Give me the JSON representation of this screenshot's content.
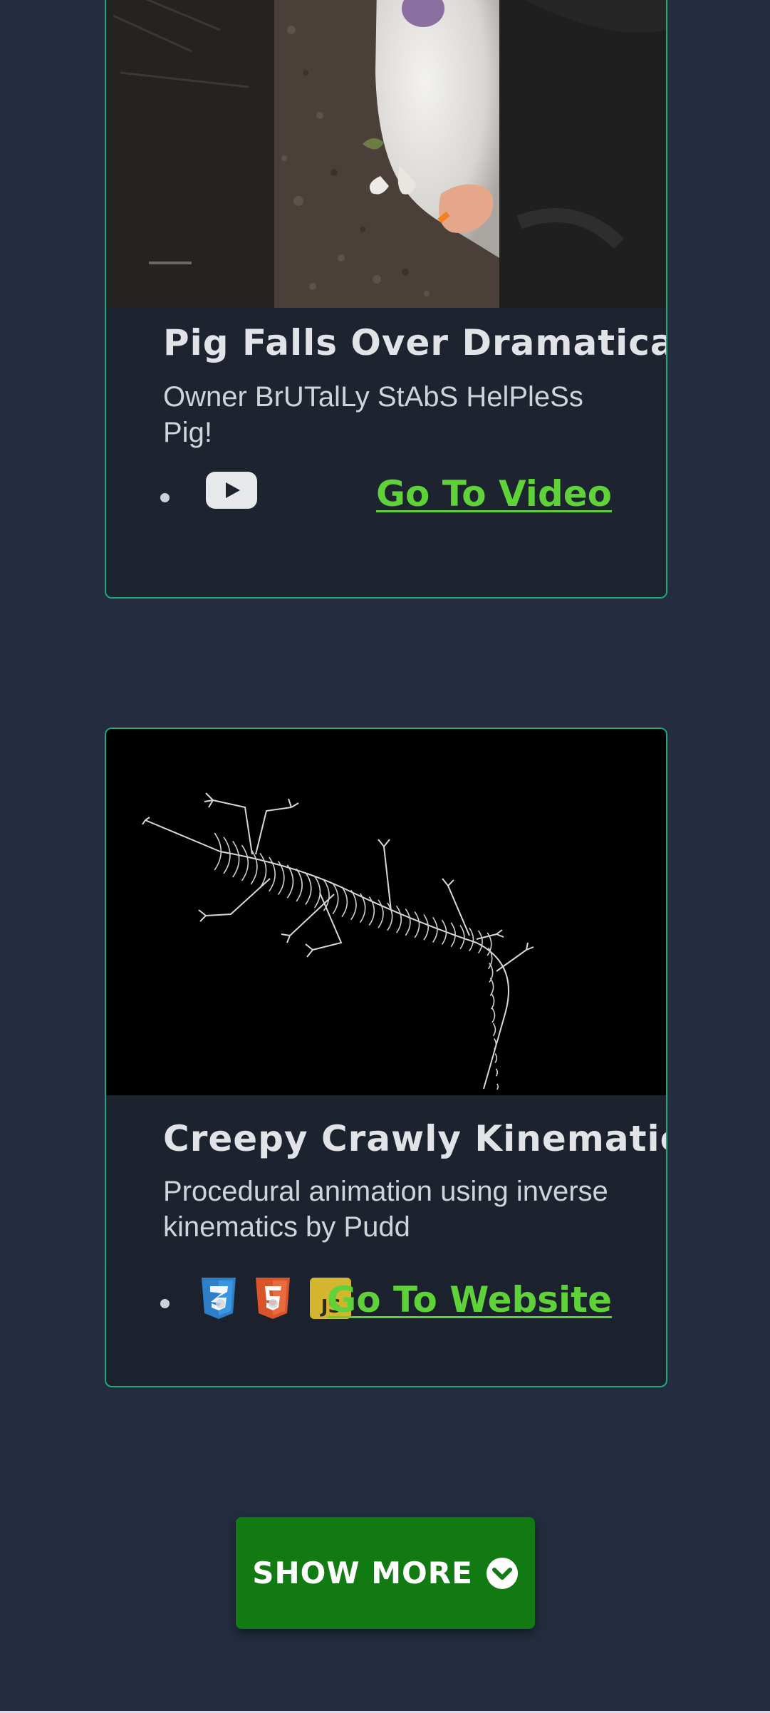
{
  "projects": [
    {
      "title": "Pig Falls Over Dramatically",
      "description": "Owner BrUTalLy StAbS HelPleSs Pig!",
      "tech_icons": [
        "youtube-icon"
      ],
      "link_label": "Go To Video"
    },
    {
      "title": "Creepy Crawly Kinematics",
      "description": "Procedural animation using inverse kinematics by Pudd",
      "tech_icons": [
        "css3-icon",
        "html5-icon",
        "javascript-icon"
      ],
      "link_label": "Go To Website"
    }
  ],
  "show_more": {
    "label": "SHOW MORE",
    "icon": "chevron-down-circle-icon"
  },
  "colors": {
    "background": "#232d3f",
    "card_border": "#1ea97c",
    "link": "#5fd23a",
    "button": "#117a13"
  }
}
